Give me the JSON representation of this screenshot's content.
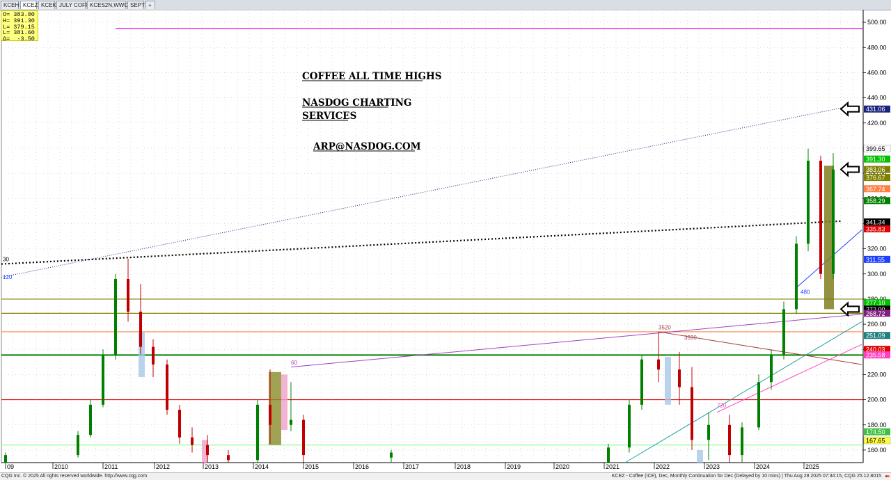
{
  "tabs": [
    "KCEH",
    "KCEZ",
    "KCEK",
    "JULY COFF",
    "KCES2N,WWC",
    "SEPT",
    "+"
  ],
  "active_tab": "KCEZ",
  "ohlc_box": [
    {
      "label": "O=",
      "value": "383.00"
    },
    {
      "label": "H=",
      "value": "391.30"
    },
    {
      "label": "L=",
      "value": "379.15"
    },
    {
      "label": "L=",
      "value": "381.60"
    },
    {
      "label": "Δ=",
      "value": "-3.50"
    }
  ],
  "annotations": {
    "title": "COFFEE ALL TIME HIGHS",
    "service_line1": "NASDOG CHARTING",
    "service_line2": "SERVICES",
    "email": "ARP@NASDOG.COM"
  },
  "footer": {
    "left": "CQG Inc. © 2025 All rights reserved worldwide. http://www.cqg.com",
    "right": "KCEZ - Coffee (ICE), Dec, Monthly Continuation for Dec (Delayed by 10 mins) | Thu Aug 28 2025 07:34:15, CQG 25.12.8015"
  },
  "chart_data": {
    "type": "candlestick",
    "instrument": "KCEZ - Coffee (ICE), Dec, Monthly Continuation for Dec",
    "ylim": [
      150,
      510
    ],
    "yticks": [
      "160.00",
      "180.00",
      "200.00",
      "220.00",
      "240.00",
      "260.00",
      "280.00",
      "300.00",
      "320.00",
      "340.00",
      "360.00",
      "380.00",
      "400.00",
      "420.00",
      "440.00",
      "460.00",
      "480.00",
      "500.00"
    ],
    "x_year_labels": [
      "09",
      "2010",
      "2011",
      "2012",
      "2013",
      "2014",
      "2015",
      "2016",
      "2017",
      "2018",
      "2019",
      "2020",
      "2021",
      "2022",
      "2023",
      "2024",
      "2025"
    ],
    "price_labels": [
      {
        "text": "431.06",
        "value": 431.06,
        "color": "#1a237e"
      },
      {
        "text": "399.65",
        "value": 399.65,
        "color": "#ffffff"
      },
      {
        "text": "391.30",
        "value": 391.3,
        "color": "#00c000"
      },
      {
        "text": "383.06",
        "value": 383.06,
        "color": "#808000"
      },
      {
        "text": "376.67",
        "value": 376.67,
        "color": "#808000"
      },
      {
        "text": "367.74",
        "value": 367.74,
        "color": "#ff8040"
      },
      {
        "text": "358.29",
        "value": 358.29,
        "color": "#008000"
      },
      {
        "text": "341.34",
        "value": 341.34,
        "color": "#000000"
      },
      {
        "text": "335.83",
        "value": 335.83,
        "color": "#e00000"
      },
      {
        "text": "311.55",
        "value": 311.55,
        "color": "#2040ff"
      },
      {
        "text": "277.10",
        "value": 277.1,
        "color": "#00c000"
      },
      {
        "text": "272.00",
        "value": 272.0,
        "color": "#000000"
      },
      {
        "text": "268.72",
        "value": 268.72,
        "color": "#802080"
      },
      {
        "text": "251.09",
        "value": 251.09,
        "color": "#208080"
      },
      {
        "text": "240.03",
        "value": 240.03,
        "color": "#e00000"
      },
      {
        "text": "235.58",
        "value": 235.58,
        "color": "#ff40c0"
      },
      {
        "text": "174.50",
        "value": 174.5,
        "color": "#40c040"
      },
      {
        "text": "167.65",
        "value": 167.65,
        "color": "#ffff40"
      }
    ],
    "horizontal_levels": [
      {
        "value": 495,
        "color": "#e000e0"
      },
      {
        "value": 280,
        "color": "#808000"
      },
      {
        "value": 268.7,
        "color": "#808000"
      },
      {
        "value": 254,
        "color": "#ff8040"
      },
      {
        "value": 235.5,
        "color": "#008000"
      },
      {
        "value": 200,
        "color": "#e00000"
      },
      {
        "value": 164,
        "color": "#80ff80"
      }
    ],
    "candles": [
      {
        "x": "2009",
        "o": 150,
        "h": 158,
        "l": 148,
        "c": 156
      },
      {
        "x": "2010-06",
        "o": 156,
        "h": 175,
        "l": 154,
        "c": 172
      },
      {
        "x": "2010-09",
        "o": 172,
        "h": 200,
        "l": 170,
        "c": 196
      },
      {
        "x": "2010-12",
        "o": 196,
        "h": 240,
        "l": 194,
        "c": 236
      },
      {
        "x": "2011-03",
        "o": 236,
        "h": 300,
        "l": 232,
        "c": 296
      },
      {
        "x": "2011-06",
        "o": 296,
        "h": 312,
        "l": 262,
        "c": 270
      },
      {
        "x": "2011-09",
        "o": 270,
        "h": 292,
        "l": 236,
        "c": 242
      },
      {
        "x": "2011-12",
        "o": 242,
        "h": 248,
        "l": 218,
        "c": 228
      },
      {
        "x": "2012-03",
        "o": 228,
        "h": 232,
        "l": 188,
        "c": 192
      },
      {
        "x": "2012-06",
        "o": 192,
        "h": 196,
        "l": 165,
        "c": 170
      },
      {
        "x": "2012-09",
        "o": 170,
        "h": 178,
        "l": 158,
        "c": 164
      },
      {
        "x": "2013-01",
        "o": 164,
        "h": 172,
        "l": 150,
        "c": 156
      },
      {
        "x": "2013-06",
        "o": 156,
        "h": 160,
        "l": 150,
        "c": 152
      },
      {
        "x": "2014-01",
        "o": 152,
        "h": 200,
        "l": 150,
        "c": 196
      },
      {
        "x": "2014-04",
        "o": 196,
        "h": 224,
        "l": 165,
        "c": 180
      },
      {
        "x": "2014-09",
        "o": 180,
        "h": 214,
        "l": 175,
        "c": 184
      },
      {
        "x": "2014-12",
        "o": 184,
        "h": 188,
        "l": 150,
        "c": 156
      },
      {
        "x": "2016-09",
        "o": 154,
        "h": 160,
        "l": 150,
        "c": 158
      },
      {
        "x": "2021-01",
        "o": 150,
        "h": 165,
        "l": 150,
        "c": 162
      },
      {
        "x": "2021-06",
        "o": 162,
        "h": 200,
        "l": 158,
        "c": 196
      },
      {
        "x": "2021-09",
        "o": 196,
        "h": 236,
        "l": 192,
        "c": 232
      },
      {
        "x": "2022-01",
        "o": 232,
        "h": 254,
        "l": 214,
        "c": 224
      },
      {
        "x": "2022-06",
        "o": 224,
        "h": 238,
        "l": 196,
        "c": 210
      },
      {
        "x": "2022-09",
        "o": 210,
        "h": 226,
        "l": 160,
        "c": 168
      },
      {
        "x": "2023-01",
        "o": 168,
        "h": 190,
        "l": 152,
        "c": 180
      },
      {
        "x": "2023-06",
        "o": 180,
        "h": 188,
        "l": 150,
        "c": 156
      },
      {
        "x": "2023-09",
        "o": 156,
        "h": 182,
        "l": 150,
        "c": 178
      },
      {
        "x": "2024-01",
        "o": 178,
        "h": 220,
        "l": 176,
        "c": 214
      },
      {
        "x": "2024-04",
        "o": 214,
        "h": 240,
        "l": 208,
        "c": 236
      },
      {
        "x": "2024-07",
        "o": 236,
        "h": 278,
        "l": 232,
        "c": 272
      },
      {
        "x": "2024-10",
        "o": 272,
        "h": 330,
        "l": 268,
        "c": 324
      },
      {
        "x": "2025-01",
        "o": 324,
        "h": 399.65,
        "l": 318,
        "c": 390
      },
      {
        "x": "2025-04",
        "o": 390,
        "h": 394,
        "l": 296,
        "c": 300
      },
      {
        "x": "2025-07",
        "o": 300,
        "h": 396,
        "l": 296,
        "c": 383
      }
    ],
    "trendlines": [
      {
        "color": "#1a237e",
        "style": "dotted",
        "from": {
          "x": "2008-06",
          "y": 294
        },
        "to": {
          "x": "2025-09",
          "y": 432
        }
      },
      {
        "color": "#000000",
        "style": "dotted-bold",
        "from": {
          "x": "2008-06",
          "y": 307
        },
        "to": {
          "x": "2025-09",
          "y": 342
        }
      }
    ],
    "text_marks": [
      "3520",
      "3590",
      "30",
      "120",
      "60",
      "480",
      "720"
    ]
  }
}
